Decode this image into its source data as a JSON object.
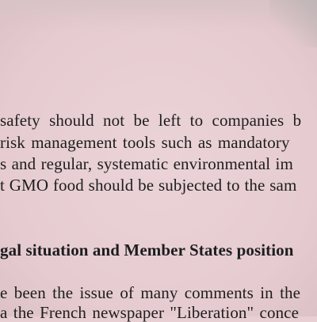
{
  "document": {
    "paragraph1": [
      "safety should not be left to companies b",
      "risk management tools such as mandatory",
      "s and regular, systematic environmental im",
      "t GMO food should be subjected to the sam"
    ],
    "section_heading": "gal situation and Member States position",
    "paragraph2": [
      "e been the issue of many comments in the",
      "a the French newspaper \"Liberation\" conce"
    ]
  }
}
